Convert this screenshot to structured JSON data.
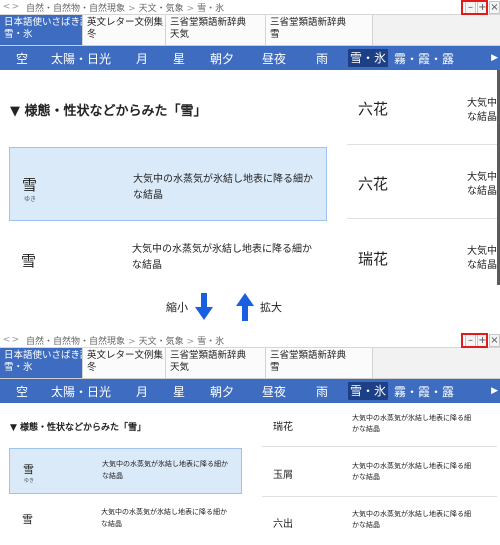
{
  "breadcrumb": {
    "back": "<",
    "forward": ">",
    "items": [
      "自然・自然物・自然現象",
      "天文・気象",
      "雪・氷"
    ]
  },
  "window_buttons": {
    "minimize": "–",
    "maximize": "+",
    "close": "×"
  },
  "dict_tabs": [
    {
      "line1": "日本語使いさばき辞典",
      "line2": "雪・氷",
      "active": true
    },
    {
      "line1": "英文レター文例集",
      "line2": "冬",
      "active": false
    },
    {
      "line1": "三省堂類語新辞典",
      "line2": "天気",
      "active": false
    },
    {
      "line1": "三省堂類語新辞典",
      "line2": "雪",
      "active": false
    }
  ],
  "categories": [
    "空",
    "太陽・日光",
    "月",
    "星",
    "朝夕",
    "昼夜",
    "雨",
    "雪・氷",
    "霧・霞・露"
  ],
  "active_category": "雪・氷",
  "section_heading": "▼ 様態・性状などからみた「雪」",
  "left_entries": [
    {
      "word": "雪",
      "ruby": "ゆき",
      "definition_line1": "大気中の水蒸気が氷結し地表に降る細か",
      "definition_line2": "な結晶",
      "selected": true
    },
    {
      "word": "雪",
      "ruby": "",
      "definition_line1": "大気中の水蒸気が氷結し地表に降る細か",
      "definition_line2": "な結晶",
      "selected": false
    }
  ],
  "right_entries_top": [
    {
      "word": "六花",
      "definition_line1": "大気中",
      "definition_line2": "な結晶"
    },
    {
      "word": "六花",
      "definition_line1": "大気中",
      "definition_line2": "な結晶"
    },
    {
      "word": "瑞花",
      "definition_line1": "大気中",
      "definition_line2": "な結晶"
    }
  ],
  "right_entries_bottom": [
    {
      "word": "瑞花",
      "definition_line1": "大気中の水蒸気が氷結し地表に降る細",
      "definition_line2": "かな結晶"
    },
    {
      "word": "玉屑",
      "definition_line1": "大気中の水蒸気が氷結し地表に降る細",
      "definition_line2": "かな結晶"
    },
    {
      "word": "六出",
      "definition_line1": "大気中の水蒸気が氷結し地表に降る細",
      "definition_line2": "かな結晶"
    }
  ],
  "zoom_hint": {
    "shrink": "縮小",
    "enlarge": "拡大"
  },
  "colors": {
    "accent": "#3d6cc0",
    "active_cat": "#1d3f86",
    "selected_bg": "#dbeaf9",
    "highlight": "#e21a1a",
    "arrow": "#1a5fe0"
  }
}
